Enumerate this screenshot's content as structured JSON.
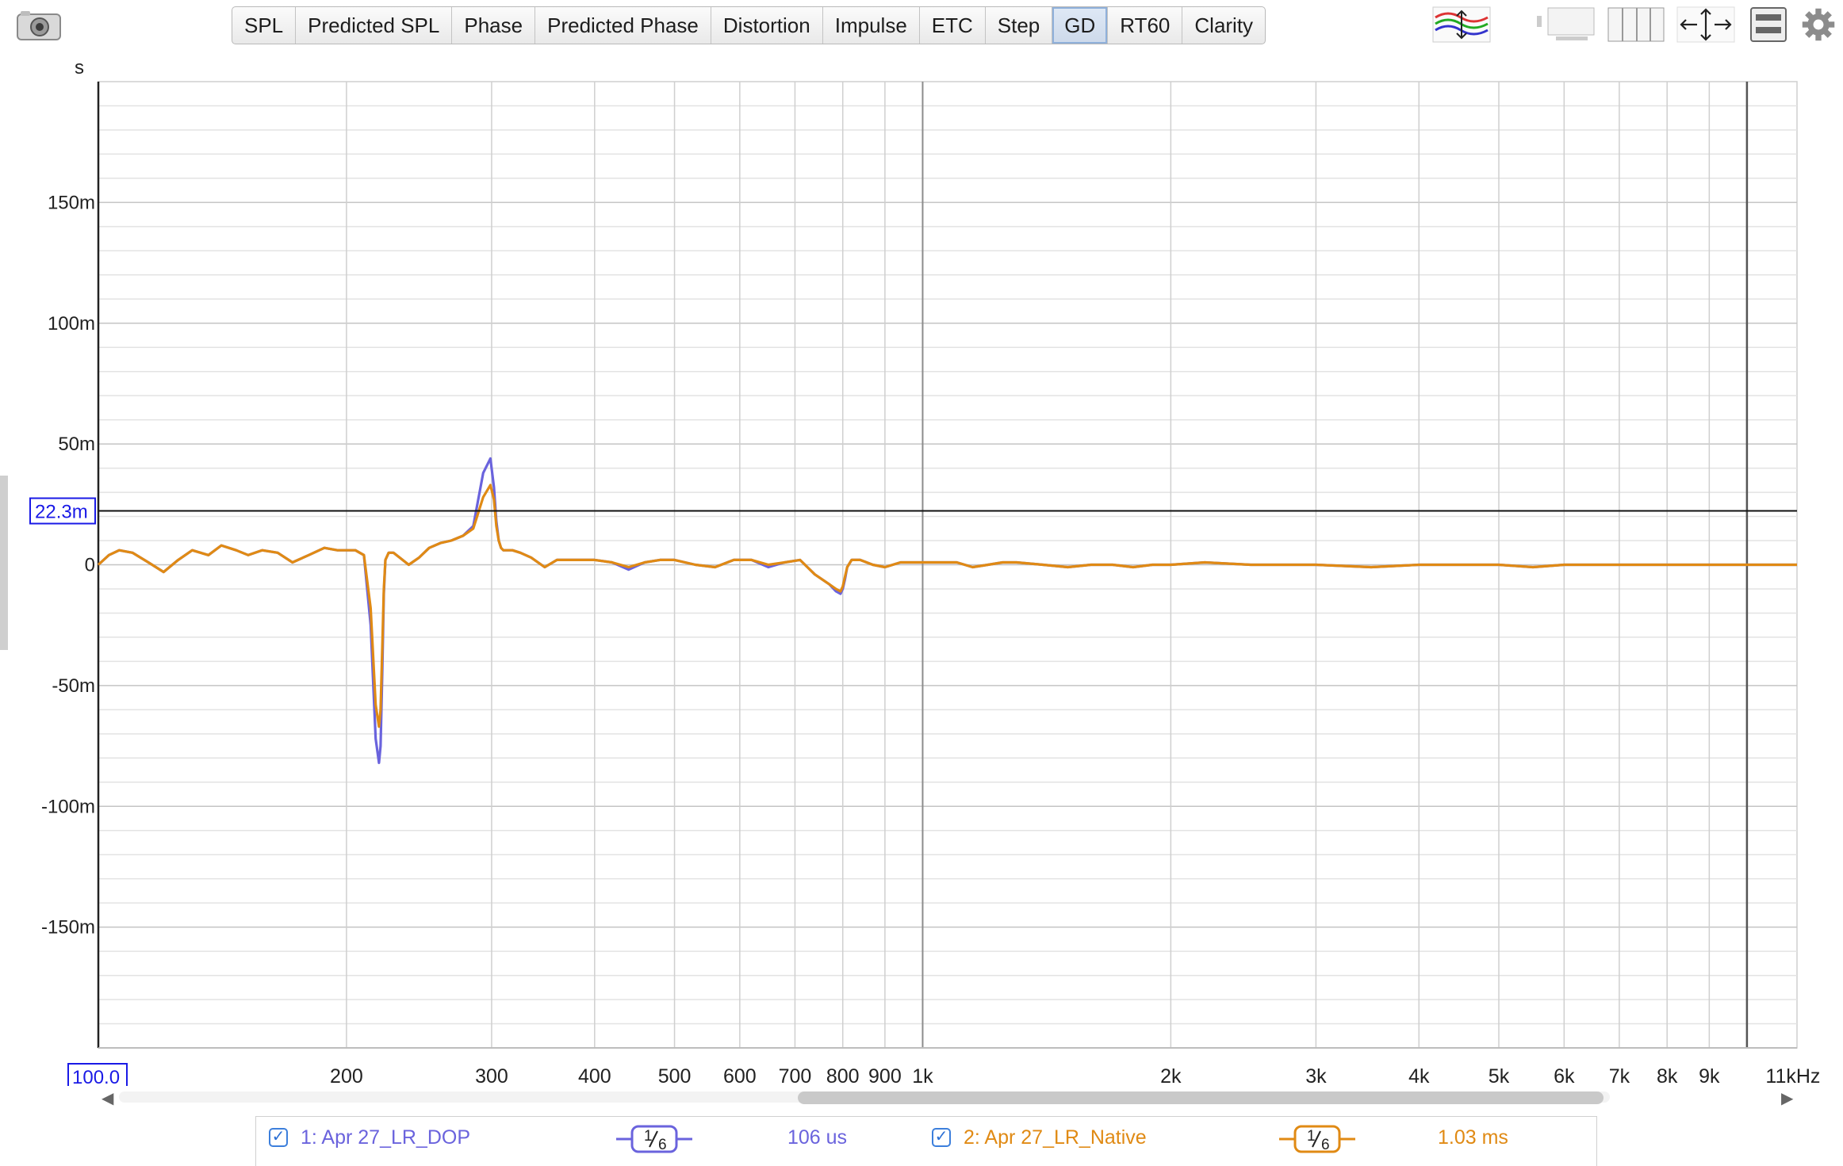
{
  "toolbar": {
    "tabs": [
      "SPL",
      "Predicted SPL",
      "Phase",
      "Predicted Phase",
      "Distortion",
      "Impulse",
      "ETC",
      "Step",
      "GD",
      "RT60",
      "Clarity"
    ],
    "active_tab": "GD",
    "icons": [
      "camera-icon",
      "overlay-traces-icon",
      "graph-limits-icon",
      "columns-icon",
      "zoom-arrows-icon",
      "controls-panel-icon",
      "settings-gear-icon"
    ]
  },
  "chart": {
    "y_unit": "s",
    "x_start_label": "100.0",
    "cursor_value": "22.3m"
  },
  "legend": {
    "items": [
      {
        "label": "1: Apr 27_LR_DOP",
        "smoothing_num": "1",
        "smoothing_den": "6",
        "value": "106 us",
        "color": "#6a63dd",
        "checked": true
      },
      {
        "label": "2: Apr 27_LR_Native",
        "smoothing_num": "1",
        "smoothing_den": "6",
        "value": "1.03 ms",
        "color": "#e08a14",
        "checked": true
      }
    ]
  },
  "chart_data": {
    "type": "line",
    "xscale": "log",
    "xlim": [
      100,
      11500
    ],
    "ylim": [
      -200,
      200
    ],
    "y_units": "ms",
    "yticks": [
      {
        "v": 150,
        "label": "150m"
      },
      {
        "v": 100,
        "label": "100m"
      },
      {
        "v": 50,
        "label": "50m"
      },
      {
        "v": 0,
        "label": "0"
      },
      {
        "v": -50,
        "label": "-50m"
      },
      {
        "v": -100,
        "label": "-100m"
      },
      {
        "v": -150,
        "label": "-150m"
      }
    ],
    "xticks": [
      {
        "v": 200,
        "label": "200"
      },
      {
        "v": 300,
        "label": "300"
      },
      {
        "v": 400,
        "label": "400"
      },
      {
        "v": 500,
        "label": "500"
      },
      {
        "v": 600,
        "label": "600"
      },
      {
        "v": 700,
        "label": "700"
      },
      {
        "v": 800,
        "label": "800"
      },
      {
        "v": 900,
        "label": "900"
      },
      {
        "v": 1000,
        "label": "1k"
      },
      {
        "v": 2000,
        "label": "2k"
      },
      {
        "v": 3000,
        "label": "3k"
      },
      {
        "v": 4000,
        "label": "4k"
      },
      {
        "v": 5000,
        "label": "5k"
      },
      {
        "v": 6000,
        "label": "6k"
      },
      {
        "v": 7000,
        "label": "7k"
      },
      {
        "v": 8000,
        "label": "8k"
      },
      {
        "v": 9000,
        "label": "9k"
      },
      {
        "v": 11000,
        "label": "11kHz"
      }
    ],
    "cursor_y": 22.3,
    "series": [
      {
        "name": "1: Apr 27_LR_DOP",
        "color": "#6a63dd",
        "x": [
          100,
          103,
          106,
          110,
          115,
          120,
          125,
          130,
          136,
          141,
          147,
          152,
          158,
          165,
          172,
          180,
          188,
          195,
          200,
          205,
          210,
          214,
          217,
          219,
          220,
          221,
          222,
          223,
          225,
          228,
          232,
          238,
          245,
          252,
          260,
          268,
          277,
          285,
          293,
          299,
          302,
          304,
          306,
          308,
          310,
          313,
          318,
          325,
          335,
          348,
          360,
          380,
          400,
          420,
          440,
          460,
          480,
          500,
          530,
          560,
          590,
          620,
          650,
          680,
          710,
          740,
          770,
          785,
          795,
          800,
          805,
          810,
          820,
          840,
          870,
          900,
          940,
          1000,
          1050,
          1100,
          1150,
          1200,
          1250,
          1300,
          1400,
          1500,
          1600,
          1700,
          1800,
          1900,
          2000,
          2200,
          2500,
          2800,
          3000,
          3500,
          4000,
          4500,
          5000,
          5500,
          6000,
          7000,
          8000,
          9000,
          10000,
          11500
        ],
        "y": [
          0,
          4,
          6,
          5,
          1,
          -3,
          2,
          6,
          4,
          8,
          6,
          4,
          6,
          5,
          1,
          4,
          7,
          6,
          6,
          6,
          4,
          -25,
          -72,
          -82,
          -75,
          -45,
          -12,
          2,
          5,
          5,
          3,
          0,
          3,
          7,
          9,
          10,
          12,
          16,
          38,
          44,
          32,
          18,
          10,
          7,
          6,
          6,
          6,
          5,
          3,
          -1,
          2,
          2,
          2,
          1,
          -2,
          1,
          2,
          2,
          0,
          -1,
          2,
          2,
          -1,
          1,
          2,
          -4,
          -8,
          -11,
          -12,
          -10,
          -6,
          -1,
          2,
          2,
          0,
          -1,
          1,
          1,
          1,
          1,
          -1,
          0,
          1,
          1,
          0,
          -1,
          0,
          0,
          -1,
          0,
          0,
          1,
          0,
          0,
          0,
          -1,
          0,
          0,
          0,
          -1,
          0,
          0,
          0,
          0,
          0,
          0
        ]
      },
      {
        "name": "2: Apr 27_LR_Native",
        "color": "#e08a14",
        "x": [
          100,
          103,
          106,
          110,
          115,
          120,
          125,
          130,
          136,
          141,
          147,
          152,
          158,
          165,
          172,
          180,
          188,
          195,
          200,
          205,
          210,
          214,
          217,
          219,
          220,
          221,
          222,
          223,
          225,
          228,
          232,
          238,
          245,
          252,
          260,
          268,
          277,
          285,
          293,
          299,
          302,
          304,
          306,
          308,
          310,
          313,
          318,
          325,
          335,
          348,
          360,
          380,
          400,
          420,
          440,
          460,
          480,
          500,
          530,
          560,
          590,
          620,
          650,
          680,
          710,
          740,
          770,
          785,
          795,
          800,
          805,
          810,
          820,
          840,
          870,
          900,
          940,
          1000,
          1050,
          1100,
          1150,
          1200,
          1250,
          1300,
          1400,
          1500,
          1600,
          1700,
          1800,
          1900,
          2000,
          2200,
          2500,
          2800,
          3000,
          3500,
          4000,
          4500,
          5000,
          5500,
          6000,
          7000,
          8000,
          9000,
          10000,
          11500
        ],
        "y": [
          0,
          4,
          6,
          5,
          1,
          -3,
          2,
          6,
          4,
          8,
          6,
          4,
          6,
          5,
          1,
          4,
          7,
          6,
          6,
          6,
          4,
          -18,
          -58,
          -67,
          -60,
          -35,
          -10,
          2,
          5,
          5,
          3,
          0,
          3,
          7,
          9,
          10,
          12,
          15,
          28,
          33,
          27,
          16,
          10,
          7,
          6,
          6,
          6,
          5,
          3,
          -1,
          2,
          2,
          2,
          1,
          -1,
          1,
          2,
          2,
          0,
          -1,
          2,
          2,
          0,
          1,
          2,
          -4,
          -8,
          -10,
          -11,
          -9,
          -5,
          -1,
          2,
          2,
          0,
          -1,
          1,
          1,
          1,
          1,
          -1,
          0,
          1,
          1,
          0,
          -1,
          0,
          0,
          -1,
          0,
          0,
          1,
          0,
          0,
          0,
          -1,
          0,
          0,
          0,
          -1,
          0,
          0,
          0,
          0,
          0,
          0
        ]
      }
    ]
  }
}
